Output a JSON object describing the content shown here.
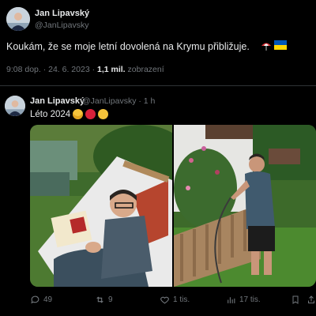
{
  "quoted": {
    "name": "Jan Lipavský",
    "handle": "@JanLipavsky",
    "text": "Koukám, že se moje letní dovolená na Krymu přibližuje.",
    "time": "9:08 dop. · 24. 6. 2023 · ",
    "views": "1,1 mil.",
    "views_label": " zobrazení",
    "flags": [
      "umbrella-beach-emoji",
      "ukraine-flag-emoji"
    ]
  },
  "reply": {
    "name": "Jan Lipavský",
    "handle": "@JanLipavsky · 1 h",
    "text": "Léto 2024",
    "emojis": [
      "sunglasses-emoji",
      "red-circle-emoji",
      "grimace-emoji"
    ],
    "images": [
      "man-reading-in-hammock-photo",
      "man-watering-garden-photo"
    ]
  },
  "actions": {
    "replies": "49",
    "reposts": "9",
    "likes": "1 tis.",
    "views": "17 tis."
  },
  "colors": {
    "background": "#000000",
    "text": "#e7e9ea",
    "muted": "#71767b",
    "divider": "#2f3336"
  }
}
